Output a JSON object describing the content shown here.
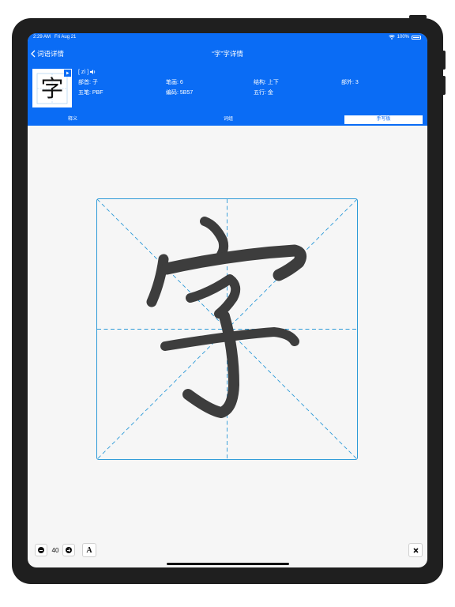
{
  "status_bar": {
    "time": "2:29 AM",
    "date": "Fri Aug 21",
    "battery": "100%"
  },
  "nav": {
    "back_label": "词语详情",
    "title": "“字”字详情"
  },
  "character": {
    "glyph": "字",
    "pinyin": "[ zì ]",
    "radical": "部首: 子",
    "strokes": "笔画: 6",
    "structure": "结构: 上下",
    "outer": "部外: 3",
    "wubi": "五笔: PBF",
    "code": "编码: 5B57",
    "wuxing": "五行: 金"
  },
  "tabs": [
    {
      "label": "释义",
      "active": false
    },
    {
      "label": "词组",
      "active": false
    },
    {
      "label": "手写板",
      "active": true
    }
  ],
  "toolbar": {
    "brush_size": "40",
    "font_button": "A"
  },
  "colors": {
    "accent": "#0a6cf5",
    "grid": "#2d9ad8",
    "ink": "#3d3d3d"
  }
}
